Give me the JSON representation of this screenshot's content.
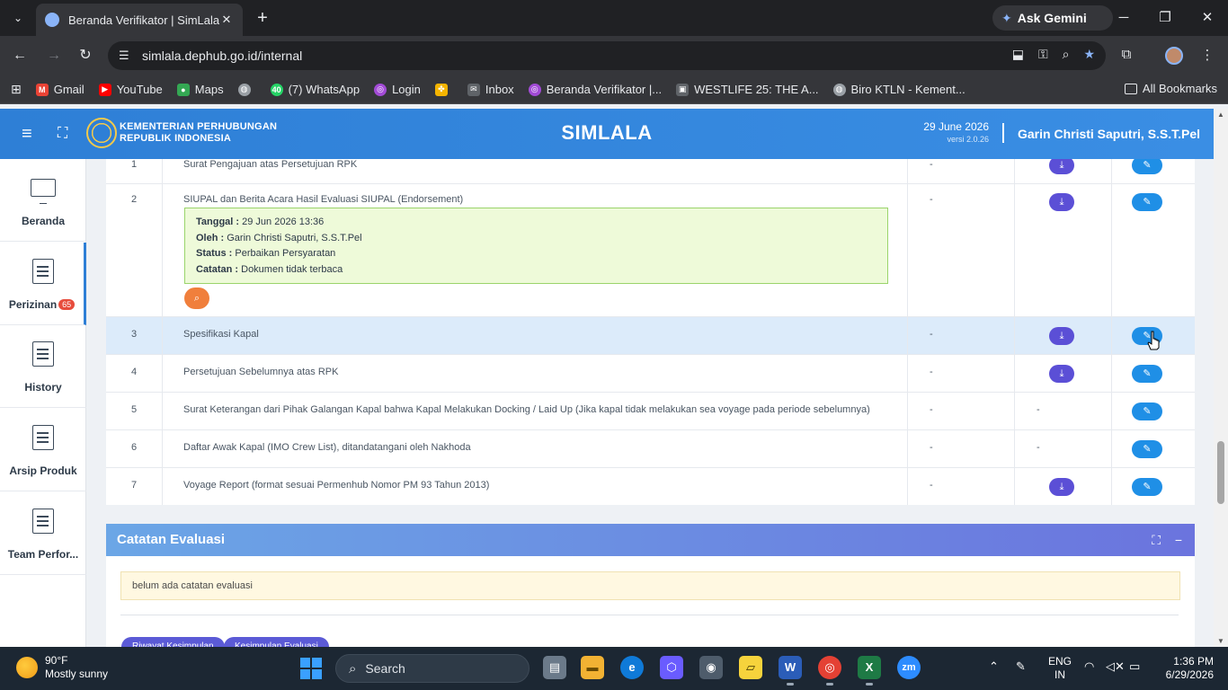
{
  "browser": {
    "tab_title": "Beranda Verifikator | SimLala",
    "url": "simlala.dephub.go.id/internal",
    "gemini_label": "Ask Gemini",
    "bookmarks": [
      {
        "label": "Gmail",
        "icon": "gmail-icon",
        "color": "#ea4335"
      },
      {
        "label": "YouTube",
        "icon": "youtube-icon",
        "color": "#ff0000"
      },
      {
        "label": "Maps",
        "icon": "maps-icon",
        "color": "#34a853"
      },
      {
        "label": "",
        "icon": "globe-icon",
        "color": "#9aa0a6"
      },
      {
        "label": "(7) WhatsApp",
        "icon": "whatsapp-icon",
        "color": "#25d366",
        "badge": "40"
      },
      {
        "label": "Login",
        "icon": "login-icon",
        "color": "#a24bd6"
      },
      {
        "label": "",
        "icon": "pinwheel-icon",
        "color": "#f4b400"
      },
      {
        "label": "Inbox",
        "icon": "mail-icon",
        "color": "#9aa0a6"
      },
      {
        "label": "Beranda Verifikator |...",
        "icon": "simlala-icon",
        "color": "#a24bd6"
      },
      {
        "label": "WESTLIFE 25: THE A...",
        "icon": "bookmark-page-icon",
        "color": "#9aa0a6"
      },
      {
        "label": "Biro KTLN - Kement...",
        "icon": "globe-icon",
        "color": "#9aa0a6"
      }
    ],
    "all_bookmarks": "All Bookmarks"
  },
  "header": {
    "ministry_line1": "KEMENTERIAN PERHUBUNGAN",
    "ministry_line2": "REPUBLIK INDONESIA",
    "brand": "SIMLALA",
    "date": "29 June 2026",
    "version": "versi 2.0.26",
    "user": "Garin Christi Saputri, S.S.T.Pel"
  },
  "sidebar": {
    "items": [
      {
        "label": "Beranda",
        "icon": "monitor-icon"
      },
      {
        "label": "Perizinan",
        "icon": "document-icon",
        "badge": "65"
      },
      {
        "label": "History",
        "icon": "document-icon"
      },
      {
        "label": "Arsip Produk",
        "icon": "document-icon"
      },
      {
        "label": "Team Perfor...",
        "icon": "document-icon"
      }
    ]
  },
  "documents": {
    "rows": [
      {
        "no": "1",
        "name": "Surat Pengajuan atas Persetujuan RPK",
        "col3": "-",
        "download": true,
        "edit": true
      },
      {
        "no": "2",
        "name": "SIUPAL dan Berita Acara Hasil Evaluasi SIUPAL (Endorsement)",
        "col3": "-",
        "download": true,
        "edit": true
      },
      {
        "no": "3",
        "name": "Spesifikasi Kapal",
        "col3": "-",
        "download": true,
        "edit": true
      },
      {
        "no": "4",
        "name": "Persetujuan Sebelumnya atas RPK",
        "col3": "-",
        "download": true,
        "edit": true
      },
      {
        "no": "5",
        "name": "Surat Keterangan dari Pihak Galangan Kapal bahwa Kapal Melakukan Docking / Laid Up (Jika kapal tidak melakukan sea voyage pada periode sebelumnya)",
        "col3": "-",
        "col4": "-",
        "download": false,
        "edit": true
      },
      {
        "no": "6",
        "name": "Daftar Awak Kapal (IMO Crew List), ditandatangani oleh Nakhoda",
        "col3": "-",
        "col4": "-",
        "download": false,
        "edit": true
      },
      {
        "no": "7",
        "name": "Voyage Report (format sesuai Permenhub Nomor PM 93 Tahun 2013)",
        "col3": "-",
        "download": true,
        "edit": true
      }
    ],
    "note": {
      "tanggal_label": "Tanggal :",
      "tanggal": "29 Jun 2026 13:36",
      "oleh_label": "Oleh :",
      "oleh": "Garin Christi Saputri, S.S.T.Pel",
      "status_label": "Status :",
      "status": "Perbaikan Persyaratan",
      "catatan_label": "Catatan :",
      "catatan": "Dokumen tidak terbaca"
    }
  },
  "evaluasi": {
    "title": "Catatan Evaluasi",
    "note": "belum ada catatan evaluasi",
    "btn_riwayat": "Riwayat Kesimpulan",
    "btn_kesimpulan": "Kesimpulan Evaluasi"
  },
  "taskbar": {
    "temp": "90°F",
    "condition": "Mostly sunny",
    "search": "Search",
    "lang1": "ENG",
    "lang2": "IN",
    "time": "1:36 PM",
    "date": "6/29/2026"
  }
}
